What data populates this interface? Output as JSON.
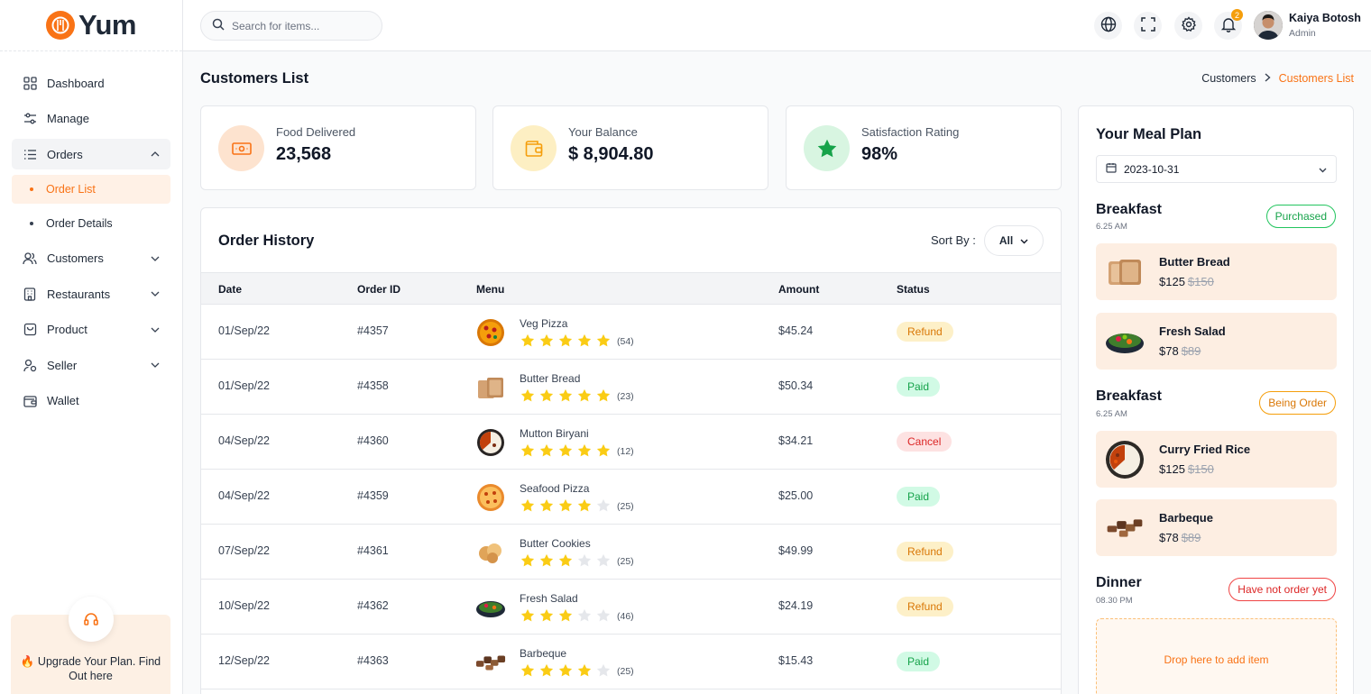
{
  "brand": {
    "name": "Yum"
  },
  "nav": {
    "items": [
      {
        "label": "Dashboard",
        "icon": "grid-icon"
      },
      {
        "label": "Manage",
        "icon": "sliders-icon"
      },
      {
        "label": "Orders",
        "icon": "list-icon"
      },
      {
        "label": "Customers",
        "icon": "users-icon"
      },
      {
        "label": "Restaurants",
        "icon": "building-icon"
      },
      {
        "label": "Product",
        "icon": "bag-icon"
      },
      {
        "label": "Seller",
        "icon": "user-icon"
      },
      {
        "label": "Wallet",
        "icon": "wallet-icon"
      }
    ],
    "orders_sub": [
      "Order List",
      "Order Details"
    ],
    "active": "Order List"
  },
  "upgrade": {
    "text": "🔥 Upgrade Your Plan. Find Out here"
  },
  "search": {
    "placeholder": "Search for items..."
  },
  "notifications": {
    "count": "2"
  },
  "user": {
    "name": "Kaiya Botosh",
    "role": "Admin"
  },
  "page": {
    "title": "Customers List",
    "breadcrumb": [
      "Customers",
      "Customers List"
    ]
  },
  "stats": [
    {
      "label": "Food Delivered",
      "value": "23,568",
      "color": "#fde3cf",
      "icon": "money-icon"
    },
    {
      "label": "Your Balance",
      "value": "$ 8,904.80",
      "color": "#fdefc3",
      "icon": "wallet-icon"
    },
    {
      "label": "Satisfaction Rating",
      "value": "98%",
      "color": "#d8f5e1",
      "icon": "star-icon"
    }
  ],
  "order_history": {
    "title": "Order History",
    "sort_label": "Sort By :",
    "sort_value": "All",
    "columns": [
      "Date",
      "Order ID",
      "Menu",
      "Amount",
      "Status"
    ],
    "rows": [
      {
        "date": "01/Sep/22",
        "id": "#4357",
        "menu": "Veg Pizza",
        "stars": 5,
        "reviews": "(54)",
        "amount": "$45.24",
        "status": "Refund"
      },
      {
        "date": "01/Sep/22",
        "id": "#4358",
        "menu": "Butter Bread",
        "stars": 5,
        "reviews": "(23)",
        "amount": "$50.34",
        "status": "Paid"
      },
      {
        "date": "04/Sep/22",
        "id": "#4360",
        "menu": "Mutton Biryani",
        "stars": 5,
        "reviews": "(12)",
        "amount": "$34.21",
        "status": "Cancel"
      },
      {
        "date": "04/Sep/22",
        "id": "#4359",
        "menu": "Seafood Pizza",
        "stars": 4,
        "reviews": "(25)",
        "amount": "$25.00",
        "status": "Paid"
      },
      {
        "date": "07/Sep/22",
        "id": "#4361",
        "menu": "Butter Cookies",
        "stars": 3,
        "reviews": "(25)",
        "amount": "$49.99",
        "status": "Refund"
      },
      {
        "date": "10/Sep/22",
        "id": "#4362",
        "menu": "Fresh Salad",
        "stars": 3,
        "reviews": "(46)",
        "amount": "$24.19",
        "status": "Refund"
      },
      {
        "date": "12/Sep/22",
        "id": "#4363",
        "menu": "Barbeque",
        "stars": 4,
        "reviews": "(25)",
        "amount": "$15.43",
        "status": "Paid"
      }
    ]
  },
  "meal_plan": {
    "title": "Your Meal Plan",
    "date": "2023-10-31",
    "sections": [
      {
        "title": "Breakfast",
        "time": "6.25 AM",
        "status": "Purchased",
        "items": [
          {
            "name": "Butter Bread",
            "price": "$125",
            "old": "$150"
          },
          {
            "name": "Fresh Salad",
            "price": "$78",
            "old": "$89"
          }
        ]
      },
      {
        "title": "Breakfast",
        "time": "6.25 AM",
        "status": "Being Order",
        "items": [
          {
            "name": "Curry Fried Rice",
            "price": "$125",
            "old": "$150"
          },
          {
            "name": "Barbeque",
            "price": "$78",
            "old": "$89"
          }
        ]
      },
      {
        "title": "Dinner",
        "time": "08.30 PM",
        "status": "Have not order yet",
        "items": []
      }
    ],
    "dropzone": "Drop here to add item"
  }
}
